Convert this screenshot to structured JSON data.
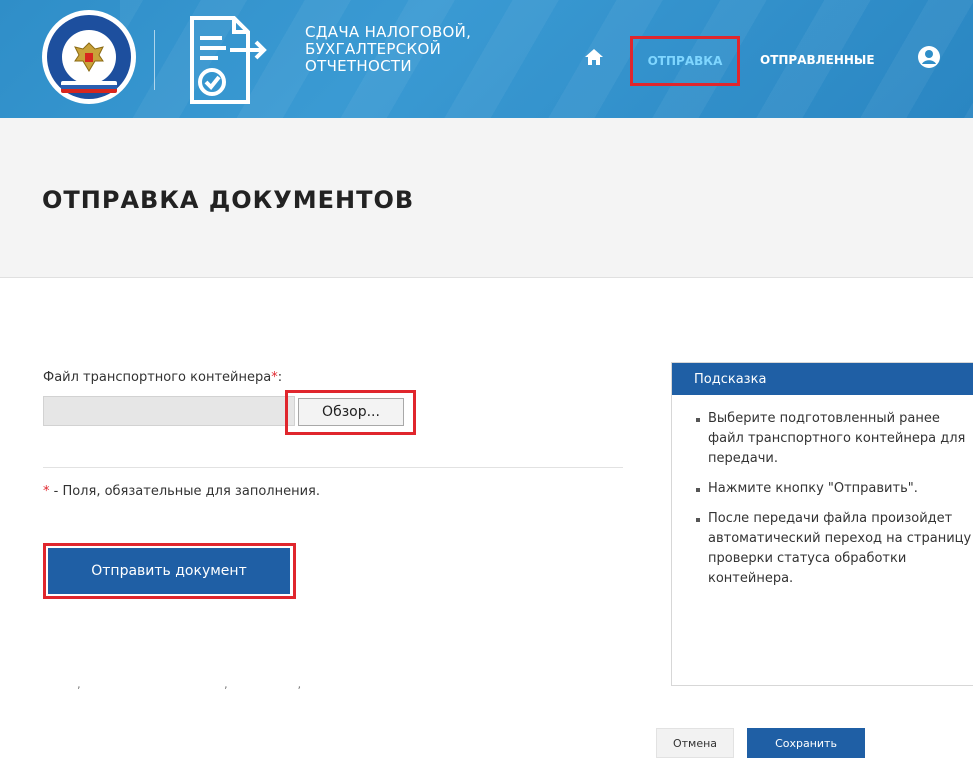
{
  "header": {
    "brand_lines": [
      "СДАЧА НАЛОГОВОЙ,",
      "БУХГАЛТЕРСКОЙ",
      "ОТЧЕТНОСТИ"
    ],
    "emblem_text": "ФЕДЕРАЛЬНАЯ НАЛОГОВАЯ СЛУЖБА",
    "nav": {
      "send": "ОТПРАВКА",
      "sent": "ОТПРАВЛЕННЫЕ"
    },
    "icons": {
      "home": "home-icon",
      "user": "user-icon",
      "document": "document-send-icon"
    }
  },
  "page": {
    "title": "ОТПРАВКА ДОКУМЕНТОВ"
  },
  "form": {
    "file_label": "Файл транспортного контейнера",
    "file_label_suffix": ":",
    "required_mark": "*",
    "browse_button": "Обзор...",
    "required_note": " - Поля, обязательные для заполнения.",
    "submit_button": "Отправить документ",
    "faint_text": "‚ ‚‚"
  },
  "hint": {
    "title": "Подсказка",
    "items": [
      "Выберите подготовленный ранее файл транспортного контейнера для передачи.",
      "Нажмите кнопку \"Отправить\".",
      "После передачи файла произойдет автоматический переход на страницу проверки статуса обработки контейнера."
    ]
  },
  "footer": {
    "cancel": "Отмена",
    "save": "Сохранить"
  },
  "colors": {
    "header_blue": "#2f8ec8",
    "accent_blue": "#1f5fa5",
    "highlight_red": "#e0262d",
    "active_nav": "#7fd6ff"
  }
}
